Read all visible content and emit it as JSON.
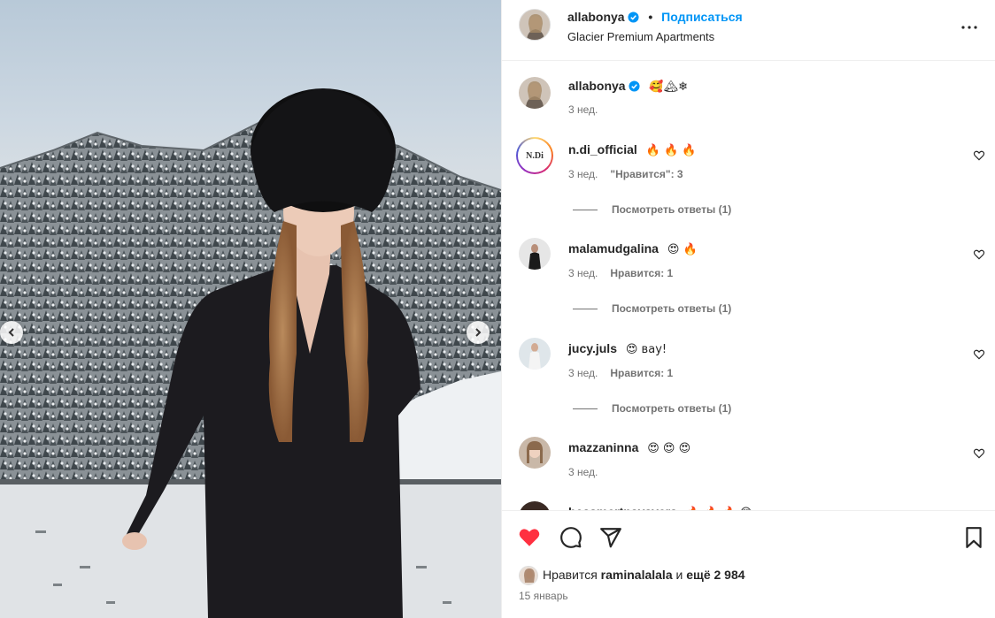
{
  "post": {
    "author": "allabonya",
    "follow_label": "Подписаться",
    "separator": "•",
    "location": "Glacier Premium Apartments"
  },
  "caption": {
    "author": "allabonya",
    "text": "🥰🏔❄",
    "time": "3 нед."
  },
  "comments": [
    {
      "user": "n.di_official",
      "text": "🔥 🔥 🔥",
      "time": "3 нед.",
      "likes": "\"Нравится\": 3",
      "replies": "Посмотреть ответы (1)",
      "avatar_label": "N.Di"
    },
    {
      "user": "malamudgalina",
      "text": "😍 🔥",
      "time": "3 нед.",
      "likes": "Нравится: 1",
      "replies": "Посмотреть ответы (1)"
    },
    {
      "user": "jucy.juls",
      "text": "😍 вау!",
      "time": "3 нед.",
      "likes": "Нравится: 1",
      "replies": "Посмотреть ответы (1)"
    },
    {
      "user": "mazzaninna",
      "text": "😍 😍 😍",
      "time": "3 нед."
    },
    {
      "user": "bessmertnayavera",
      "text": "🔥 🔥 🔥 😍"
    }
  ],
  "footer": {
    "liked_by_prefix": "Нравится",
    "liked_by_user": "raminalalala",
    "liked_by_and": "и",
    "liked_by_count": "ещё 2 984",
    "date": "15 январь"
  },
  "icons": {
    "like": "heart-filled-icon",
    "comment": "comment-icon",
    "share": "share-icon",
    "save": "bookmark-icon",
    "more": "more-icon",
    "verified": "verified-badge-icon"
  },
  "colors": {
    "accent": "#0095f6",
    "liked": "#ff3040",
    "muted": "#737373"
  }
}
